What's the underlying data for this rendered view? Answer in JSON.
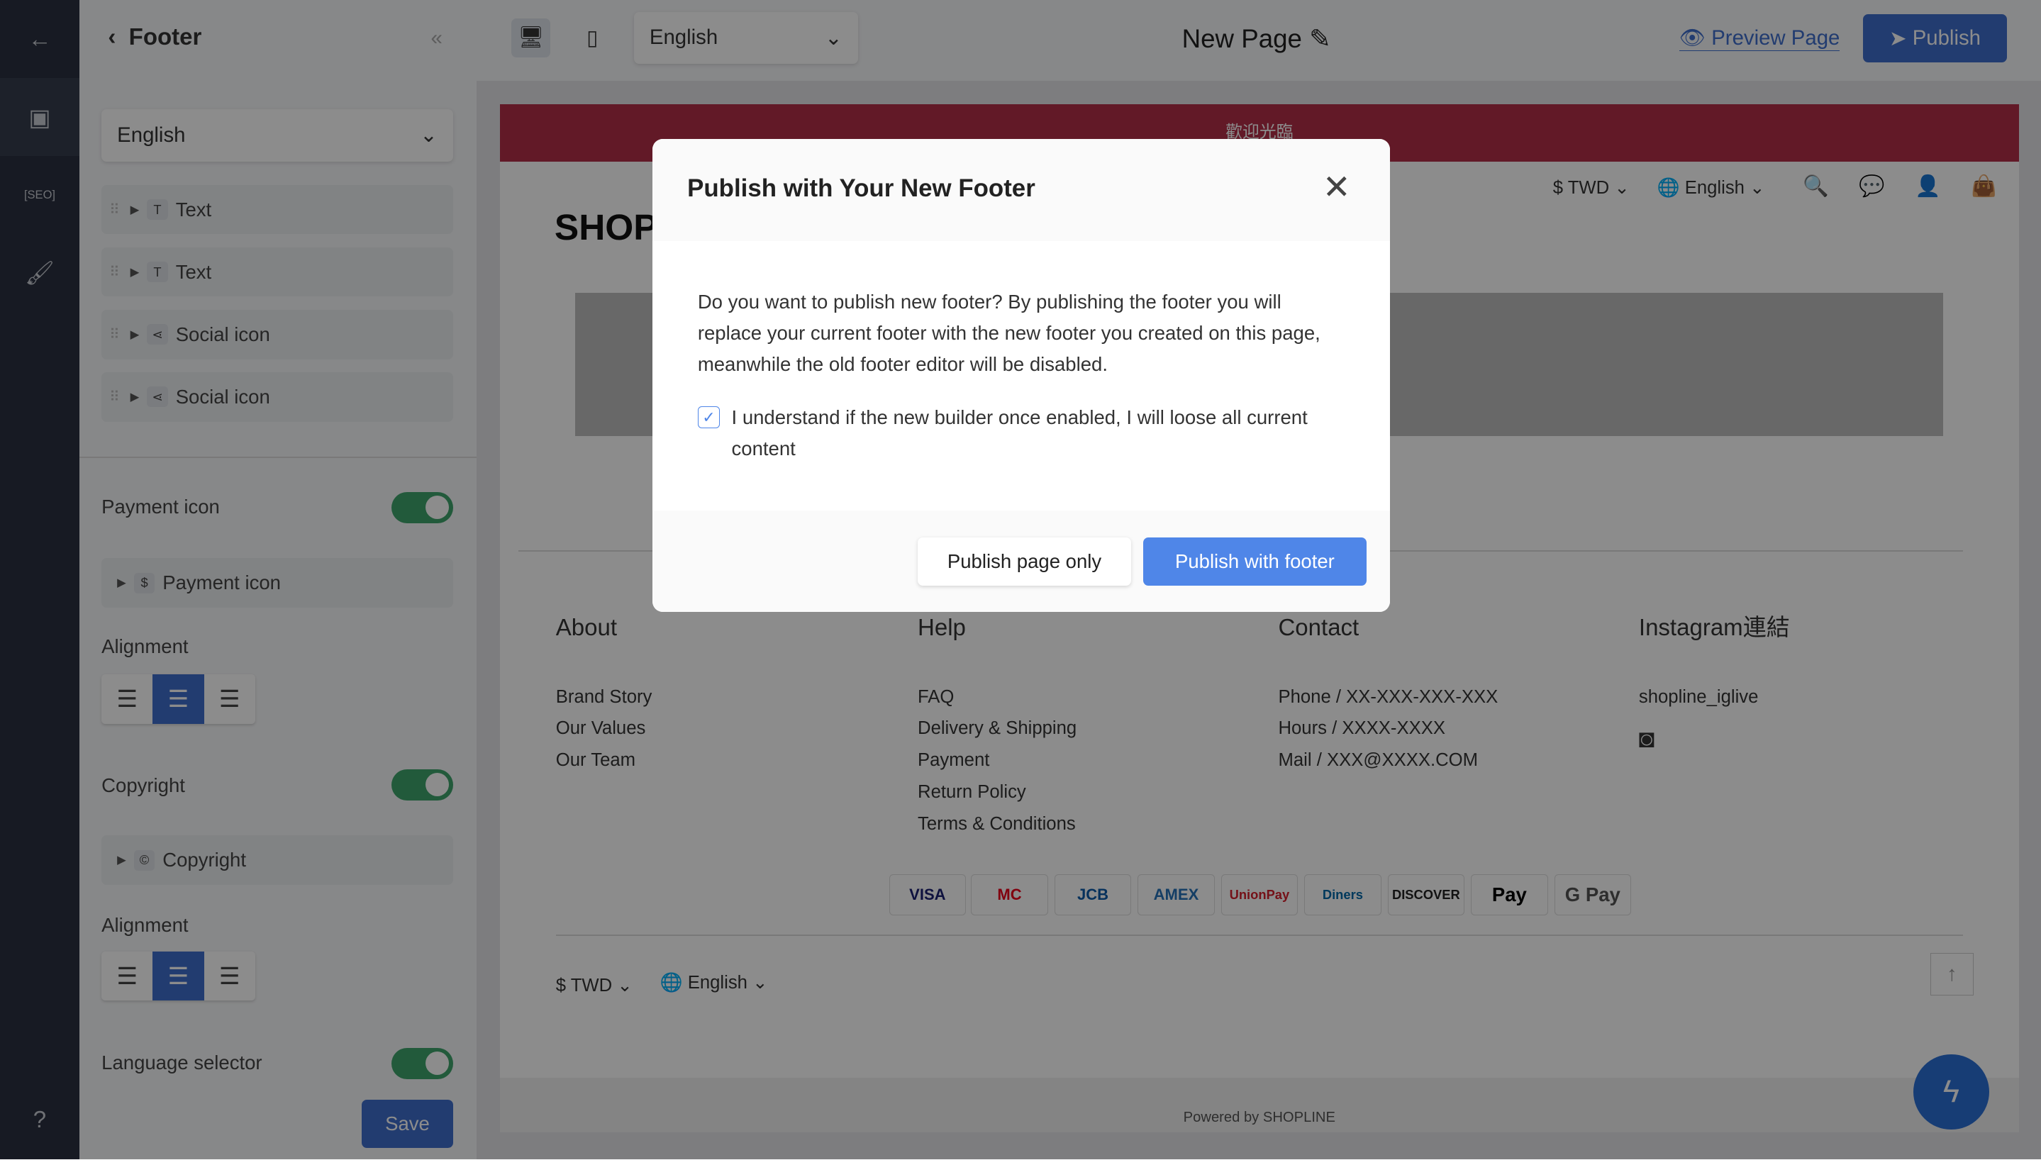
{
  "rail": {
    "items": [
      "back-icon",
      "layout-icon",
      "seo-icon",
      "paint-roller-icon",
      "help-icon"
    ]
  },
  "panel": {
    "title": "Footer",
    "language": "English",
    "items": [
      {
        "label": "Text",
        "icon": "text-icon"
      },
      {
        "label": "Text",
        "icon": "text-icon"
      },
      {
        "label": "Social icon",
        "icon": "share-icon"
      },
      {
        "label": "Social icon",
        "icon": "share-icon"
      }
    ],
    "payment_icon_label": "Payment icon",
    "payment_icon_on": true,
    "payment_item": "Payment icon",
    "alignment_label": "Alignment",
    "copyright_label": "Copyright",
    "copyright_on": true,
    "copyright_item": "Copyright",
    "alignment2_label": "Alignment",
    "language_selector_label": "Language selector",
    "language_selector_on": true,
    "save": "Save"
  },
  "topbar": {
    "language": "English",
    "page_title": "New Page",
    "preview": "Preview Page",
    "publish": "Publish"
  },
  "store": {
    "banner": "歡迎光臨",
    "logo": "SHOP",
    "currency": "$ TWD",
    "language": "English",
    "columns": [
      {
        "title": "About",
        "links": [
          "Brand Story",
          "Our Values",
          "Our Team"
        ]
      },
      {
        "title": "Help",
        "links": [
          "FAQ",
          "Delivery & Shipping",
          "Payment",
          "Return Policy",
          "Terms & Conditions"
        ]
      },
      {
        "title": "Contact",
        "links": [
          "Phone / XX-XXX-XXX-XXX",
          "Hours / XXXX-XXXX",
          "Mail / XXX@XXXX.COM"
        ]
      },
      {
        "title": "Instagram連結",
        "links": [
          "shopline_iglive"
        ]
      }
    ],
    "payments": [
      "VISA",
      "MC",
      "JCB",
      "AMEX",
      "UnionPay",
      "Diners",
      "DISCOVER",
      "Pay",
      "G Pay"
    ],
    "footer_currency": "$ TWD",
    "footer_language": "English",
    "powered": "Powered by SHOPLINE"
  },
  "modal": {
    "title": "Publish with Your New Footer",
    "body": "Do you want to publish new footer? By publishing the footer you will replace your current footer with the new footer you created on this page, meanwhile the old footer editor will be disabled.",
    "checkbox_label": "I understand if the new builder once enabled, I will loose all current content",
    "checked": true,
    "secondary": "Publish page only",
    "primary": "Publish with footer",
    "accent": "#4f86e8"
  }
}
